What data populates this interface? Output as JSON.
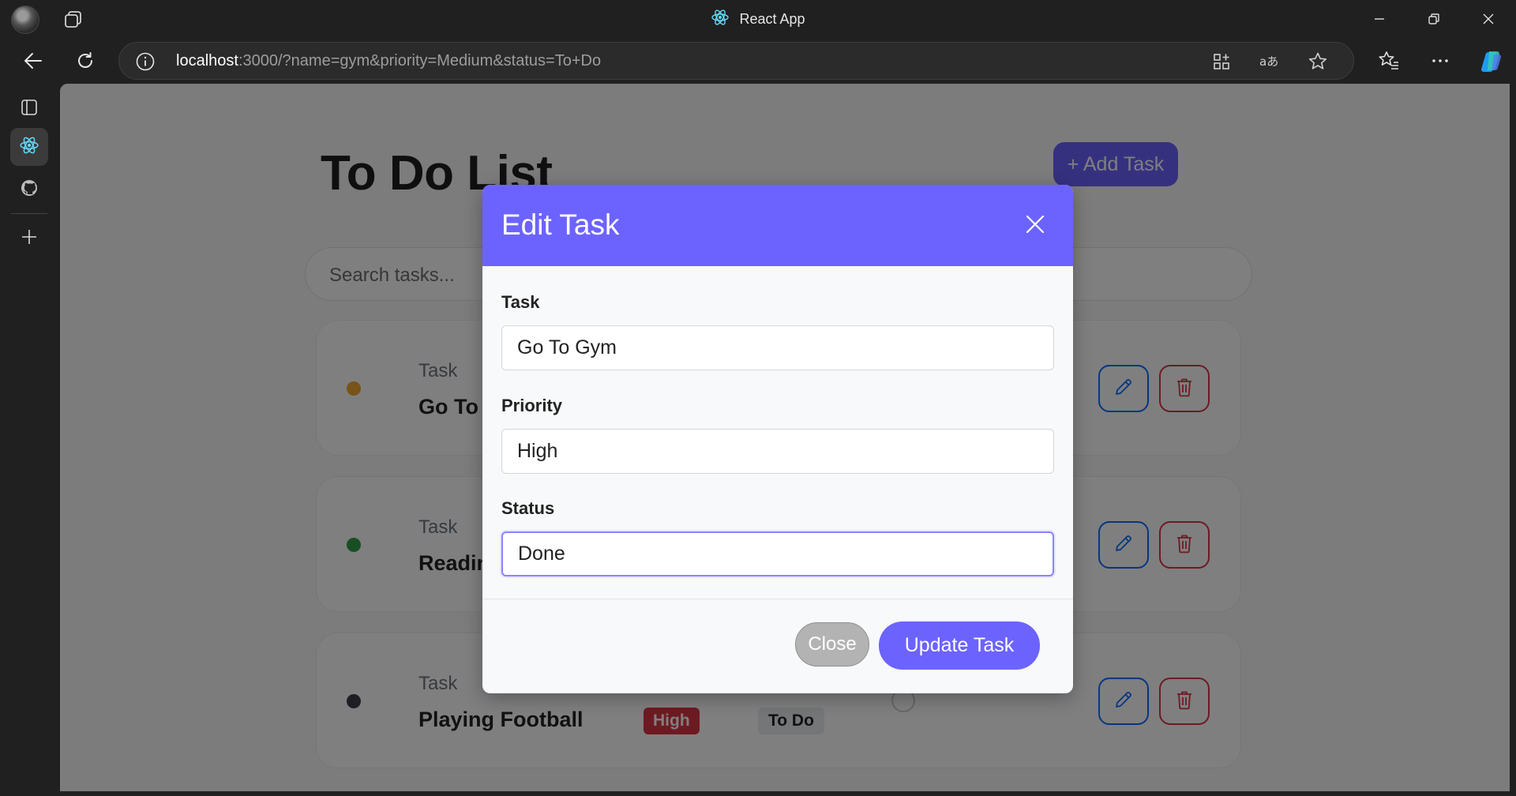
{
  "browser": {
    "window_title": "React App",
    "url_host": "localhost",
    "url_rest": ":3000/?name=gym&priority=Medium&status=To+Do"
  },
  "page": {
    "title": "To Do List",
    "add_task_label": "+ Add Task",
    "search_placeholder": "Search tasks..."
  },
  "tasks": [
    {
      "label": "Task",
      "name": "Go To Gym",
      "dot_color": "#f0a830"
    },
    {
      "label": "Task",
      "name": "Reading",
      "dot_color": "#2e9e47"
    },
    {
      "label": "Task",
      "name": "Playing Football",
      "dot_color": "#3a3f4a",
      "priority": "High",
      "status": "To Do"
    }
  ],
  "modal": {
    "title": "Edit Task",
    "task_label": "Task",
    "task_value": "Go To Gym",
    "priority_label": "Priority",
    "priority_value": "High",
    "status_label": "Status",
    "status_value": "Done",
    "close_label": "Close",
    "update_label": "Update Task"
  },
  "colors": {
    "accent": "#6c63ff",
    "danger": "#dc3545",
    "primary": "#0d6efd"
  }
}
